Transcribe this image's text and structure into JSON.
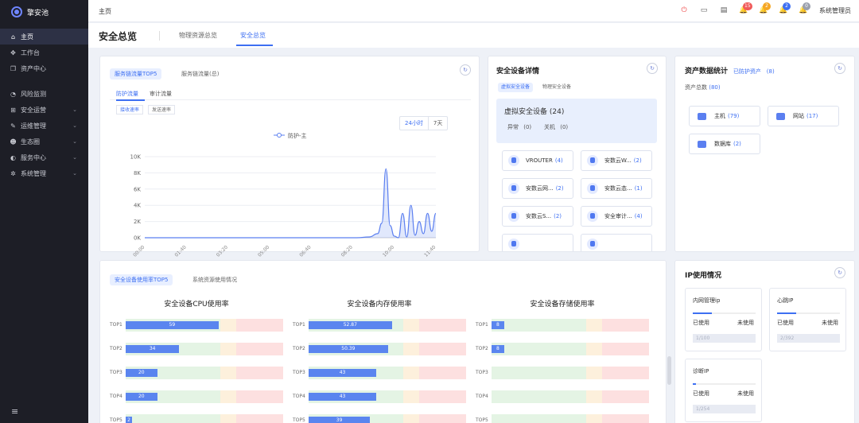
{
  "app": {
    "title": "擎安池"
  },
  "sidebar": {
    "items": [
      {
        "label": "主页",
        "icon": "home-icon",
        "glyph": "⌂",
        "active": true,
        "chevron": false
      },
      {
        "label": "工作台",
        "icon": "workbench-icon",
        "glyph": "✥",
        "active": false,
        "chevron": false
      },
      {
        "label": "资产中心",
        "icon": "box-icon",
        "glyph": "❐",
        "active": false,
        "chevron": false
      },
      {
        "label": "风险监测",
        "icon": "gauge-icon",
        "glyph": "◔",
        "active": false,
        "chevron": false,
        "gap": true
      },
      {
        "label": "安全运营",
        "icon": "grid-icon",
        "glyph": "⊞",
        "active": false,
        "chevron": true
      },
      {
        "label": "运维管理",
        "icon": "wrench-icon",
        "glyph": "✎",
        "active": false,
        "chevron": true
      },
      {
        "label": "生态圈",
        "icon": "users-icon",
        "glyph": "☻",
        "active": false,
        "chevron": true
      },
      {
        "label": "服务中心",
        "icon": "headset-icon",
        "glyph": "◐",
        "active": false,
        "chevron": true
      },
      {
        "label": "系统管理",
        "icon": "gear-icon",
        "glyph": "✲",
        "active": false,
        "chevron": true
      }
    ],
    "chevron_glyph": "⌄",
    "collapse_glyph": "≡"
  },
  "topbar": {
    "breadcrumb": "主页",
    "icons": [
      {
        "name": "power-icon",
        "glyph": "⏻",
        "color": "#e44",
        "badge": null
      },
      {
        "name": "monitor-icon",
        "glyph": "▭",
        "color": "#555",
        "badge": null
      },
      {
        "name": "document-icon",
        "glyph": "▤",
        "color": "#555",
        "badge": null
      },
      {
        "name": "bell-alert-icon",
        "glyph": "🔔",
        "color": "#e44",
        "badge": "15",
        "badge_color": "#f05a5a"
      },
      {
        "name": "bell-warning-icon",
        "glyph": "🔔",
        "color": "#e90",
        "badge": "2",
        "badge_color": "#f5a623"
      },
      {
        "name": "bell-info-icon",
        "glyph": "🔔",
        "color": "#36f",
        "badge": "2",
        "badge_color": "#3d6ff2"
      },
      {
        "name": "bell-muted-icon",
        "glyph": "🔔",
        "color": "#888",
        "badge": "0",
        "badge_color": "#9aa0ad"
      }
    ],
    "user": "系统管理员"
  },
  "page": {
    "title": "安全总览",
    "tabs": [
      {
        "label": "物理资源总览",
        "active": false
      },
      {
        "label": "安全总览",
        "active": true
      }
    ]
  },
  "traffic": {
    "tabs": [
      {
        "label": "服务链流量TOP5",
        "active": true
      },
      {
        "label": "服务链流量(总)",
        "active": false
      }
    ],
    "subtabs": [
      {
        "label": "防护流量",
        "active": true
      },
      {
        "label": "审计流量",
        "active": false
      }
    ],
    "segments": [
      {
        "label": "接收速率",
        "active": true
      },
      {
        "label": "发送速率",
        "active": false
      }
    ],
    "ranges": [
      {
        "label": "24小时",
        "active": true
      },
      {
        "label": "7天",
        "active": false
      }
    ],
    "refresh_glyph": "↻"
  },
  "devices": {
    "title": "安全设备详情",
    "tabs": [
      {
        "label": "虚拟安全设备",
        "active": true
      },
      {
        "label": "物理安全设备",
        "active": false
      }
    ],
    "summary_title": "虚拟安全设备",
    "summary_count": "(24)",
    "status": [
      {
        "label": "异常",
        "value": "(0)"
      },
      {
        "label": "关机",
        "value": "(0)"
      }
    ],
    "items": [
      {
        "label": "VROUTER",
        "count": "(4)"
      },
      {
        "label": "安数云W...",
        "count": "(2)"
      },
      {
        "label": "安数云网...",
        "count": "(2)"
      },
      {
        "label": "安数云态...",
        "count": "(1)"
      },
      {
        "label": "安数云S...",
        "count": "(2)"
      },
      {
        "label": "安全审计...",
        "count": "(4)"
      }
    ]
  },
  "assets": {
    "title": "资产数据统计",
    "protected_label": "已防护资产",
    "protected_count": "(8)",
    "total_label": "资产总数",
    "total_count": "(80)",
    "items": [
      {
        "label": "主机",
        "count": "(79)"
      },
      {
        "label": "网站",
        "count": "(17)"
      },
      {
        "label": "数据库",
        "count": "(2)"
      }
    ]
  },
  "usage": {
    "tabs": [
      {
        "label": "安全设备使用率TOP5",
        "active": true
      },
      {
        "label": "系统资源使用情况",
        "active": false
      }
    ],
    "groups": [
      {
        "title": "安全设备CPU使用率",
        "rows": [
          {
            "label": "TOP1",
            "value": 59,
            "text": "59"
          },
          {
            "label": "TOP2",
            "value": 34,
            "text": "34"
          },
          {
            "label": "TOP3",
            "value": 20,
            "text": "20"
          },
          {
            "label": "TOP4",
            "value": 20,
            "text": "20"
          },
          {
            "label": "TOP5",
            "value": 2,
            "text": "2"
          }
        ]
      },
      {
        "title": "安全设备内存使用率",
        "rows": [
          {
            "label": "TOP1",
            "value": 52.87,
            "text": "52.87"
          },
          {
            "label": "TOP2",
            "value": 50.39,
            "text": "50.39"
          },
          {
            "label": "TOP3",
            "value": 43,
            "text": "43"
          },
          {
            "label": "TOP4",
            "value": 43,
            "text": "43"
          },
          {
            "label": "TOP5",
            "value": 39,
            "text": "39"
          }
        ]
      },
      {
        "title": "安全设备存储使用率",
        "rows": [
          {
            "label": "TOP1",
            "value": 8,
            "text": "8"
          },
          {
            "label": "TOP2",
            "value": 8,
            "text": "8"
          },
          {
            "label": "TOP3",
            "value": 0,
            "text": ""
          },
          {
            "label": "TOP4",
            "value": 0,
            "text": ""
          },
          {
            "label": "TOP5",
            "value": 0,
            "text": ""
          }
        ]
      }
    ]
  },
  "ip": {
    "title": "IP使用情况",
    "boxes": [
      {
        "title": "内网管理ip",
        "used_label": "已使用",
        "free_label": "未使用",
        "value": "1/100",
        "used_fraction": 0.3
      },
      {
        "title": "心跳IP",
        "used_label": "已使用",
        "free_label": "未使用",
        "value": "2/392",
        "used_fraction": 0.3
      },
      {
        "title": "诊断IP",
        "used_label": "已使用",
        "free_label": "未使用",
        "value": "1/254",
        "used_fraction": 0.05
      }
    ]
  },
  "chart_data": {
    "type": "line",
    "series": [
      {
        "name": "防护-主"
      }
    ],
    "x": [
      "00:00",
      "00:30",
      "01:00",
      "01:30",
      "02:00",
      "02:30",
      "03:00",
      "03:30",
      "04:00",
      "04:30",
      "05:00",
      "05:30",
      "06:00",
      "06:30",
      "07:00",
      "07:30",
      "08:00",
      "08:30",
      "09:00",
      "09:20",
      "09:30",
      "09:40",
      "09:50",
      "10:00",
      "10:10",
      "10:20",
      "10:30",
      "10:40",
      "10:50",
      "11:00",
      "11:10",
      "11:20",
      "11:30",
      "11:40"
    ],
    "values": [
      0,
      0,
      0,
      0,
      0,
      0,
      0,
      0,
      0,
      0,
      0,
      0,
      0,
      0,
      0,
      0,
      0,
      0,
      100,
      500,
      1800,
      8500,
      1500,
      200,
      0,
      3000,
      100,
      4000,
      300,
      2000,
      500,
      3000,
      800,
      3000
    ],
    "tick_labels": [
      "00:00",
      "01:40",
      "03:20",
      "05:00",
      "06:40",
      "08:20",
      "10:00",
      "11:40"
    ],
    "y_ticks": [
      "10K",
      "8K",
      "6K",
      "4K",
      "2K",
      "0K"
    ],
    "ylim": [
      0,
      10000
    ],
    "grid": true,
    "legend": "top-center",
    "color": "#5b7ff0"
  }
}
